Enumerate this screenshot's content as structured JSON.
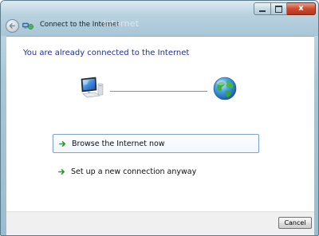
{
  "window": {
    "title": "Connect to the Internet",
    "title_glow": "Internet",
    "caption_buttons": {
      "minimize_icon": "minimize-icon",
      "maximize_icon": "maximize-icon",
      "close_label": "x"
    },
    "back_icon": "back-arrow-icon"
  },
  "main": {
    "heading": "You are already connected to the Internet",
    "diagram": {
      "left_icon": "computer-icon",
      "right_icon": "globe-icon"
    },
    "options": [
      {
        "label": "Browse the Internet now",
        "icon": "green-arrow-icon",
        "selected": true
      },
      {
        "label": "Set up a new connection anyway",
        "icon": "green-arrow-icon",
        "selected": false
      }
    ]
  },
  "footer": {
    "cancel_label": "Cancel"
  },
  "colors": {
    "heading": "#1e3287",
    "arrow": "#2e9a2e",
    "selection_border": "#7da2ce"
  }
}
